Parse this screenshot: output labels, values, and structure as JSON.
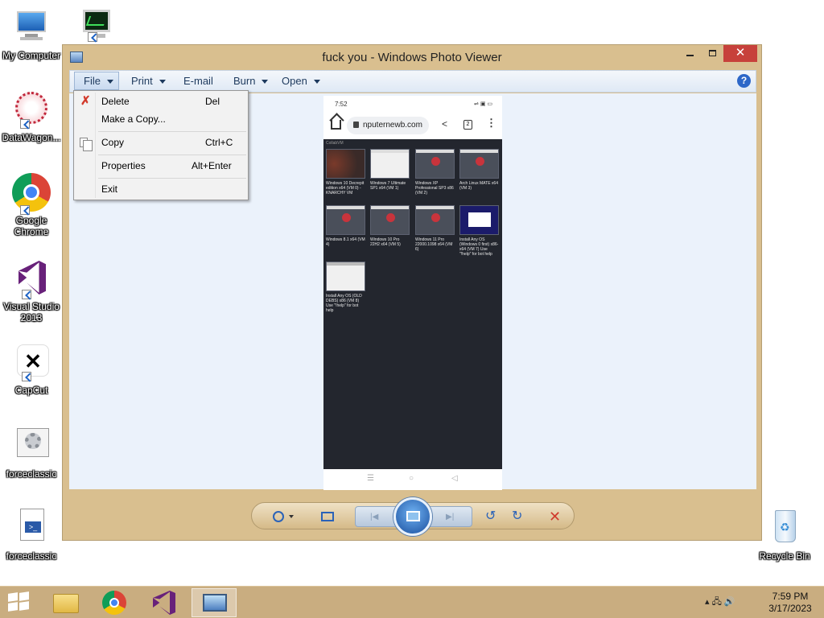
{
  "desktop": {
    "icons": [
      {
        "label": "My Computer"
      },
      {
        "label": ""
      },
      {
        "label": "DataWagon..."
      },
      {
        "label": "Google Chrome"
      },
      {
        "label": "Visual Studio 2013"
      },
      {
        "label": "CapCut"
      },
      {
        "label": "forceclassic"
      },
      {
        "label": "forceclassic"
      },
      {
        "label": "Recycle Bin"
      }
    ]
  },
  "window": {
    "title": "fuck you - Windows Photo Viewer",
    "close_glyph": "✕",
    "menu": {
      "file": "File",
      "print": "Print",
      "email": "E-mail",
      "burn": "Burn",
      "open": "Open",
      "help": "?"
    },
    "file_menu": {
      "items": [
        {
          "label": "Delete",
          "shortcut": "Del"
        },
        {
          "label": "Make a Copy...",
          "shortcut": ""
        },
        {
          "label": "Copy",
          "shortcut": "Ctrl+C"
        },
        {
          "label": "Properties",
          "shortcut": "Alt+Enter"
        },
        {
          "label": "Exit",
          "shortcut": ""
        }
      ]
    }
  },
  "photo": {
    "status_time": "7:52",
    "status_icons": "⇌ ▣ ▭",
    "url": "nputernewb.com",
    "tab_count": "2",
    "page_header": "CollabVM",
    "tiles": [
      {
        "caption": "Windows 10 Decrepit edition x64 (VM 0) - KNARCHY VM"
      },
      {
        "caption": "Windows 7 Ultimate SP1 x64 (VM 1)"
      },
      {
        "caption": "Windows XP Professional SP3 x86 (VM 2)"
      },
      {
        "caption": "Arch Linux MATE x64 (VM 3)"
      },
      {
        "caption": "Windows 8.1 x64 (VM 4)"
      },
      {
        "caption": "Windows 10 Pro 22H2 x64 (VM 5)"
      },
      {
        "caption": "Windows 11 Pro 22000.1098 x64 (VM 6)"
      },
      {
        "caption": "Install Any OS (Windows 0 first) x86-x64 (VM 7) Use \"!help\" for bot help"
      },
      {
        "caption": "Install Any OS (OLD DEBS) x86 (VM 8) Use \"!help\" for bot help"
      }
    ],
    "nav": {
      "menu": "☰",
      "home": "○",
      "back": "◁"
    }
  },
  "taskbar": {
    "clock_time": "7:59 PM",
    "clock_date": "3/17/2023",
    "tray_icons": "▴  🖧  🔊"
  }
}
